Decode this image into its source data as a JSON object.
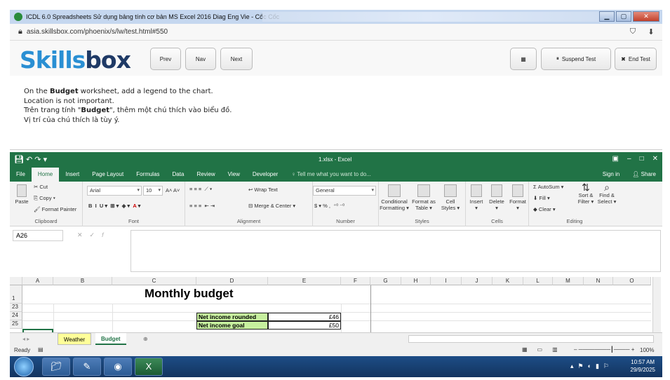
{
  "browser": {
    "window_title": "ICDL 6.0 Spreadsheets Sử dụng bảng tính cơ bản MS Excel 2016 Diag Eng Vie - Cốc Cốc",
    "url": "asia.skillsbox.com/phoenix/s/lw/test.html#550"
  },
  "skillsbox": {
    "logo_a": "Skills",
    "logo_b": "box",
    "prev": "Prev",
    "nav": "Nav",
    "next": "Next",
    "suspend": "Suspend Test",
    "end": "End Test"
  },
  "instructions": {
    "l1_a": "On the ",
    "l1_b": "Budget",
    "l1_c": " worksheet, add a legend to the chart.",
    "l2": "Location is not important.",
    "l3_a": "Trên trang tính \"",
    "l3_b": "Budget",
    "l3_c": "\", thêm một chú thích vào biểu đồ.",
    "l4": "Vị trí của chú thích là tùy ý."
  },
  "excel": {
    "doc_title": "1.xlsx - Excel",
    "tabs": [
      "File",
      "Home",
      "Insert",
      "Page Layout",
      "Formulas",
      "Data",
      "Review",
      "View",
      "Developer"
    ],
    "tell_me": "Tell me what you want to do...",
    "sign_in": "Sign in",
    "share": "Share",
    "ribbon": {
      "paste": "Paste",
      "cut": "Cut",
      "copy": "Copy",
      "format_painter": "Format Painter",
      "clipboard": "Clipboard",
      "font_name": "Arial",
      "font_size": "10",
      "font": "Font",
      "wrap": "Wrap Text",
      "merge": "Merge & Center",
      "alignment": "Alignment",
      "number_format": "General",
      "number": "Number",
      "cond1": "Conditional",
      "cond2": "Formatting",
      "fmt1": "Format as",
      "fmt2": "Table",
      "cell1": "Cell",
      "cell2": "Styles",
      "styles": "Styles",
      "insert": "Insert",
      "delete": "Delete",
      "format": "Format",
      "cells": "Cells",
      "autosum": "AutoSum",
      "fill": "Fill",
      "clear": "Clear",
      "sort1": "Sort &",
      "sort2": "Filter",
      "find1": "Find &",
      "find2": "Select",
      "editing": "Editing"
    },
    "name_box": "A26",
    "columns": [
      "A",
      "B",
      "C",
      "D",
      "E",
      "F",
      "G",
      "H",
      "I",
      "J",
      "K",
      "L",
      "M",
      "N",
      "O"
    ],
    "rows": [
      "1",
      "23",
      "24",
      "25"
    ],
    "sheet_title": "Monthly budget",
    "cells": [
      {
        "label": "Net income rounded",
        "value": "£46"
      },
      {
        "label": "Net income goal",
        "value": "£50"
      }
    ],
    "sheets": [
      "Weather",
      "Budget"
    ],
    "status_ready": "Ready",
    "zoom": "100%"
  },
  "taskbar": {
    "time": "10:57 AM",
    "date": "29/9/2025"
  }
}
